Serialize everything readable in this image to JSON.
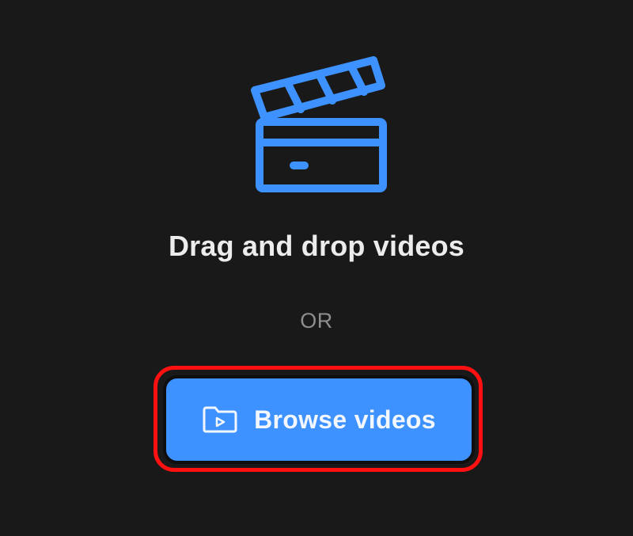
{
  "upload": {
    "icon": "clapperboard-icon",
    "headline": "Drag and drop videos",
    "separator": "OR",
    "browse_button": {
      "icon": "folder-video-icon",
      "label": "Browse videos"
    }
  },
  "colors": {
    "background": "#191919",
    "accent": "#3e92ff",
    "highlight": "#ff1111",
    "headline_text": "#ececec",
    "separator_text": "#8e8e8e"
  }
}
